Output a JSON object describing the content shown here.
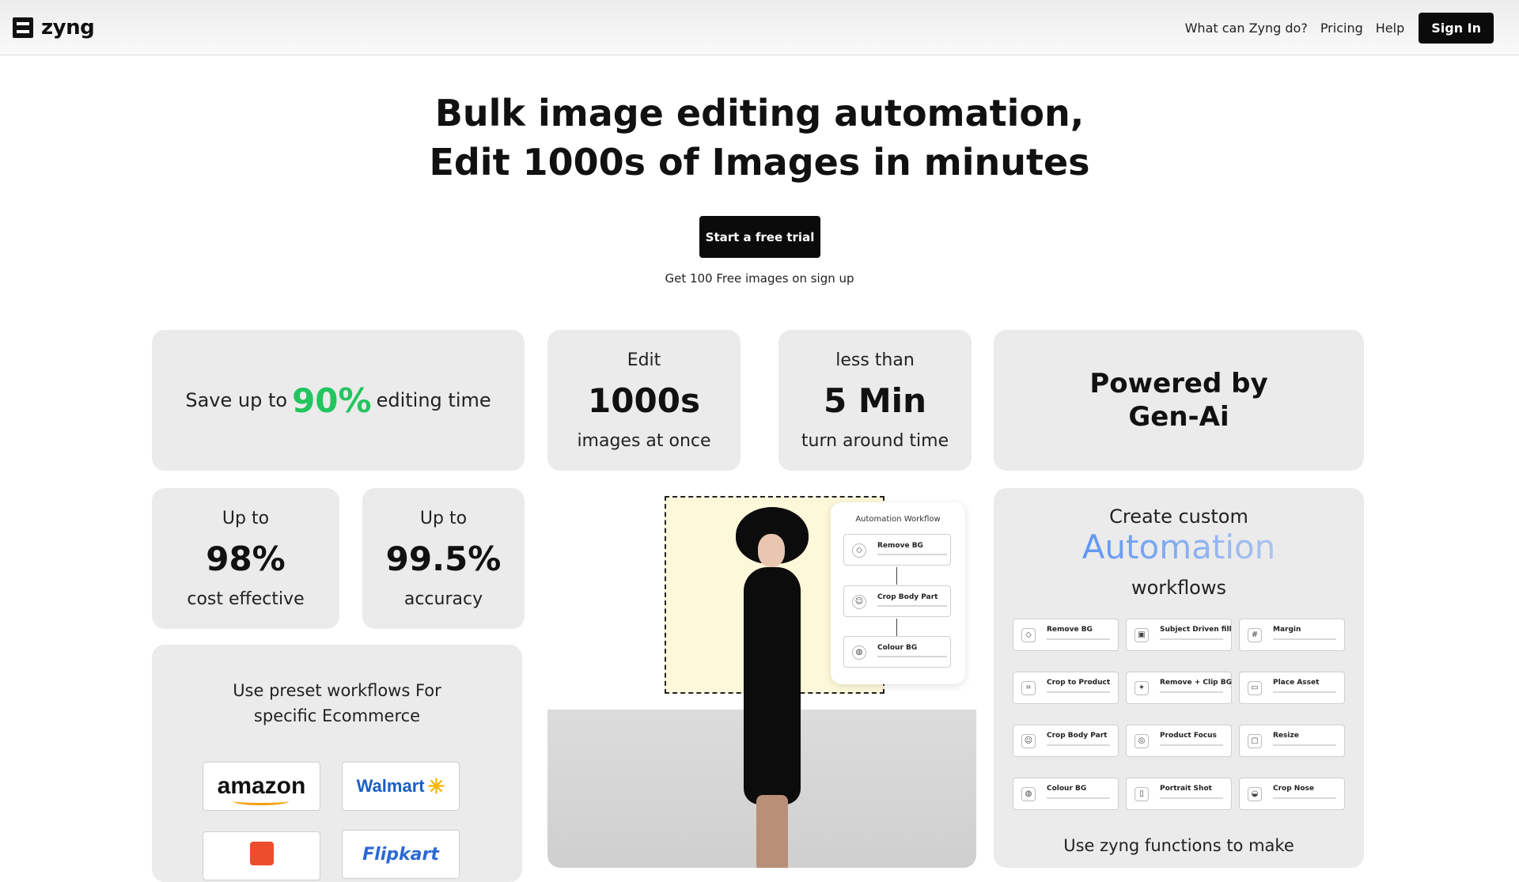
{
  "nav": {
    "brand": "zyng",
    "links": [
      "What can Zyng do?",
      "Pricing",
      "Help"
    ],
    "sign_in": "Sign In"
  },
  "hero": {
    "title_line1": "Bulk image editing automation,",
    "title_line2": "Edit 1000s of Images in minutes",
    "cta": "Start a free trial",
    "subtext": "Get 100 Free images on sign up"
  },
  "stats": {
    "save": {
      "prefix": "Save up to",
      "highlight": "90%",
      "suffix": "editing time",
      "highlight_color": "#22c55e"
    },
    "edit": {
      "top": "Edit",
      "big": "1000s",
      "bottom": "images at once"
    },
    "turnaround": {
      "top": "less than",
      "big": "5 Min",
      "bottom": "turn around time"
    },
    "powered": {
      "line1": "Powered by",
      "line2": "Gen-Ai"
    },
    "cost": {
      "top": "Up to",
      "big": "98%",
      "bottom": "cost effective"
    },
    "accuracy": {
      "top": "Up to",
      "big": "99.5%",
      "bottom": "accuracy"
    }
  },
  "preset": {
    "title_line1": "Use preset workflows For",
    "title_line2": "specific Ecommerce",
    "brands": [
      "amazon",
      "Walmart",
      "Flipkart"
    ]
  },
  "workflow_panel": {
    "title": "Automation Workflow",
    "steps": [
      "Remove BG",
      "Crop Body Part",
      "Colour BG"
    ]
  },
  "automation": {
    "line1": "Create custom",
    "line2": "Automation",
    "line3": "workflows",
    "tiles": [
      "Remove BG",
      "Subject Driven fill",
      "Margin",
      "Crop to Product",
      "Remove + Clip BG",
      "Place Asset",
      "Crop Body Part",
      "Product Focus",
      "Resize",
      "Colour BG",
      "Portrait Shot",
      "Crop Nose"
    ],
    "footer": "Use zyng functions to make"
  }
}
